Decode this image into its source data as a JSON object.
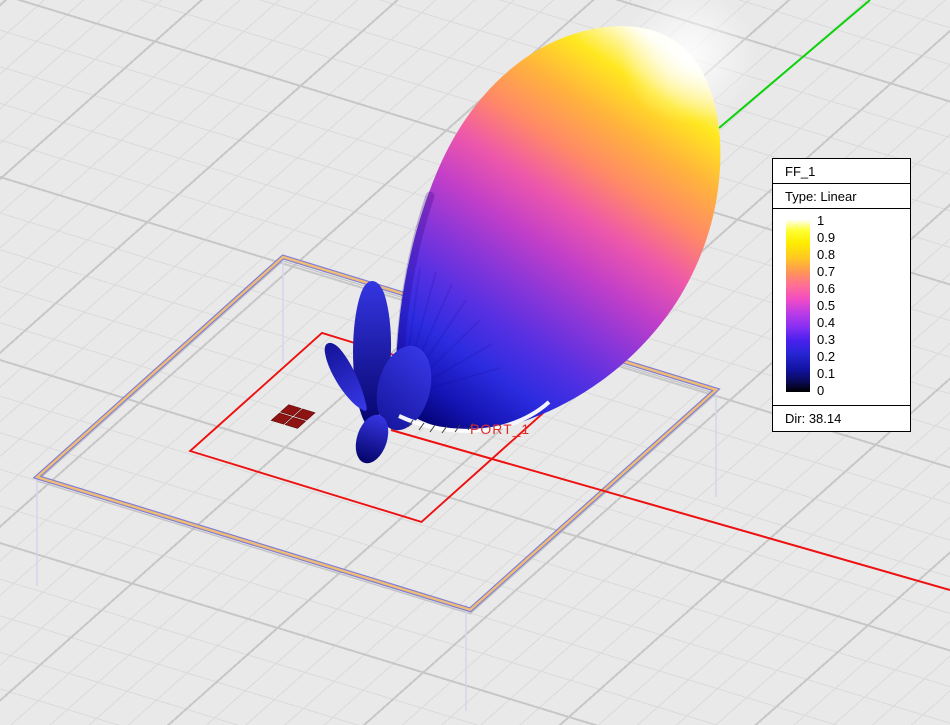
{
  "viewport": {
    "port_label": "PORT_1",
    "port_label_color": "#e02a2a",
    "axes": {
      "x_color": "#ee1111",
      "y_color": "#0bd20b"
    },
    "board": {
      "edge_core": "#f1bc74",
      "edge_border": "#7e7ed6",
      "corner_line": "#d6d6ec",
      "underside_line": "#c2c2c2"
    },
    "model": {
      "patch_fill": "#8e1313",
      "patch_stroke": "#5e0909",
      "outline_color": "#ee1111"
    },
    "pattern": {
      "name": "FF_1",
      "side_lobe_dark": "#06066e",
      "side_lobe_mid": "#15159c",
      "side_lobe_bright": "#3636e4",
      "main_lobe_stops": [
        {
          "offset": 0,
          "color": "#00006a"
        },
        {
          "offset": 0.09,
          "color": "#1414b4"
        },
        {
          "offset": 0.19,
          "color": "#2c2ce0"
        },
        {
          "offset": 0.29,
          "color": "#5530e2"
        },
        {
          "offset": 0.39,
          "color": "#8a36d8"
        },
        {
          "offset": 0.49,
          "color": "#c33fc8"
        },
        {
          "offset": 0.59,
          "color": "#ee58aa"
        },
        {
          "offset": 0.69,
          "color": "#ff8868"
        },
        {
          "offset": 0.8,
          "color": "#ffb43c"
        },
        {
          "offset": 0.9,
          "color": "#ffe820"
        },
        {
          "offset": 1,
          "color": "#fffff4"
        }
      ]
    }
  },
  "legend": {
    "title": "FF_1",
    "type_label": "Type: Linear",
    "dir_label": "Dir: 38.14",
    "ticks": [
      "1",
      "0.9",
      "0.8",
      "0.7",
      "0.6",
      "0.5",
      "0.4",
      "0.3",
      "0.2",
      "0.1",
      "0"
    ],
    "colorbar_stops": [
      {
        "pos": 0,
        "color": "#fffff2"
      },
      {
        "pos": 0.06,
        "color": "#ffff36"
      },
      {
        "pos": 0.13,
        "color": "#ffee00"
      },
      {
        "pos": 0.22,
        "color": "#ffc822"
      },
      {
        "pos": 0.3,
        "color": "#ff9655"
      },
      {
        "pos": 0.38,
        "color": "#ff6f94"
      },
      {
        "pos": 0.46,
        "color": "#f24cc4"
      },
      {
        "pos": 0.54,
        "color": "#bc3ce6"
      },
      {
        "pos": 0.62,
        "color": "#8830f2"
      },
      {
        "pos": 0.7,
        "color": "#4a20ee"
      },
      {
        "pos": 0.78,
        "color": "#2525d2"
      },
      {
        "pos": 0.87,
        "color": "#1212a0"
      },
      {
        "pos": 0.94,
        "color": "#0a0a55"
      },
      {
        "pos": 1,
        "color": "#000000"
      }
    ]
  }
}
